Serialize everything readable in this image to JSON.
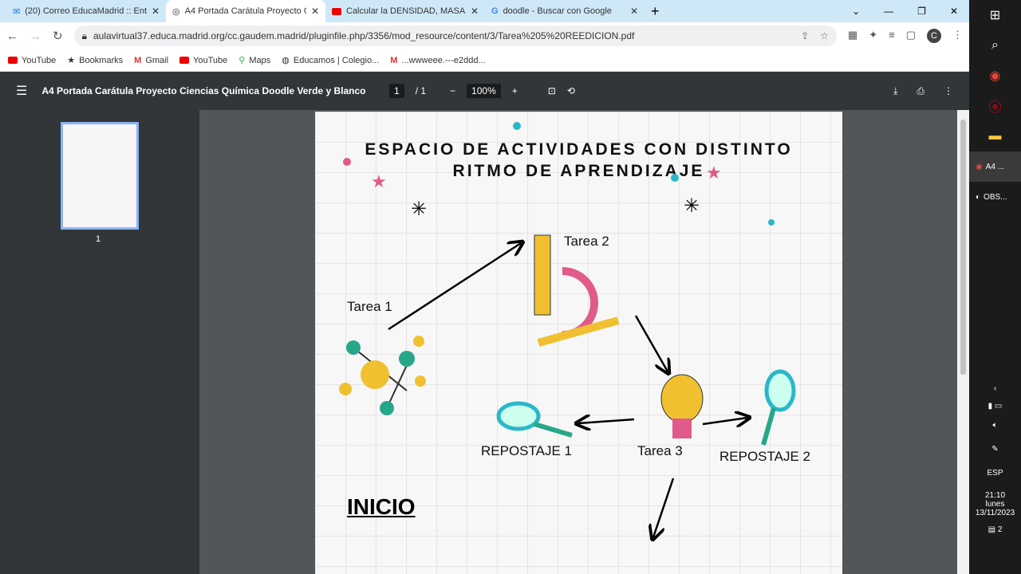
{
  "tabs": [
    {
      "label": "(20) Correo EducaMadrid :: Entr"
    },
    {
      "label": "A4 Portada Carátula Proyecto C"
    },
    {
      "label": "Calcular la DENSIDAD, MASA y"
    },
    {
      "label": "doodle - Buscar con Google"
    }
  ],
  "url": "aulavirtual37.educa.madrid.org/cc.gaudem.madrid/pluginfile.php/3356/mod_resource/content/3/Tarea%205%20REEDICION.pdf",
  "bookmarks": [
    "YouTube",
    "Bookmarks",
    "Gmail",
    "YouTube",
    "Maps",
    "Educamos | Colegio...",
    "...wwweee.---e2ddd..."
  ],
  "pdf": {
    "title": "A4 Portada Carátula Proyecto Ciencias Química Doodle Verde y Blanco",
    "page": "1",
    "total": "/ 1",
    "zoom": "100%",
    "thumb_num": "1"
  },
  "doc": {
    "title1": "ESPACIO DE ACTIVIDADES CON DISTINTO",
    "title2": "RITMO DE APRENDIZAJE",
    "t1": "Tarea 1",
    "t2": "Tarea 2",
    "t3": "Tarea 3",
    "r1": "REPOSTAJE 1",
    "r2": "REPOSTAJE 2",
    "inicio": "INICIO"
  },
  "taskbar": {
    "app1": "A4 ...",
    "app2": "OBS...",
    "lang": "ESP",
    "time": "21:10",
    "day": "lunes",
    "date": "13/11/2023",
    "notif": "2"
  }
}
